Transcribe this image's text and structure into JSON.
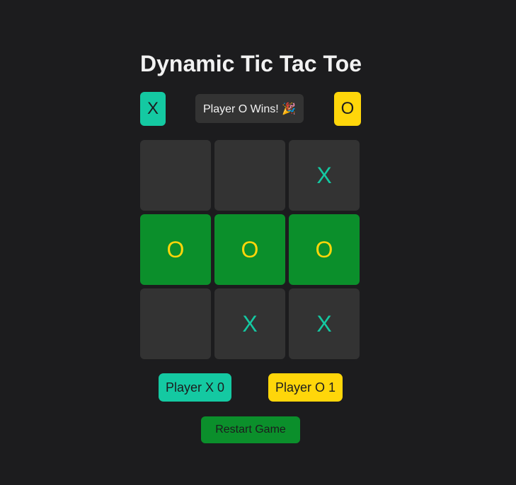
{
  "title": "Dynamic Tic Tac Toe",
  "turn_indicators": {
    "x_label": "X",
    "o_label": "O"
  },
  "status": "Player O Wins! 🎉",
  "board": {
    "cells": [
      "",
      "",
      "X",
      "O",
      "O",
      "O",
      "",
      "X",
      "X"
    ],
    "winning_cells": [
      3,
      4,
      5
    ]
  },
  "scores": {
    "x": "Player X 0",
    "o": "Player O 1"
  },
  "restart_label": "Restart Game",
  "colors": {
    "background": "#1c1c1e",
    "x_color": "#14c9a2",
    "o_color": "#ffd60a",
    "cell": "#333333",
    "win": "#0b8f2b"
  }
}
